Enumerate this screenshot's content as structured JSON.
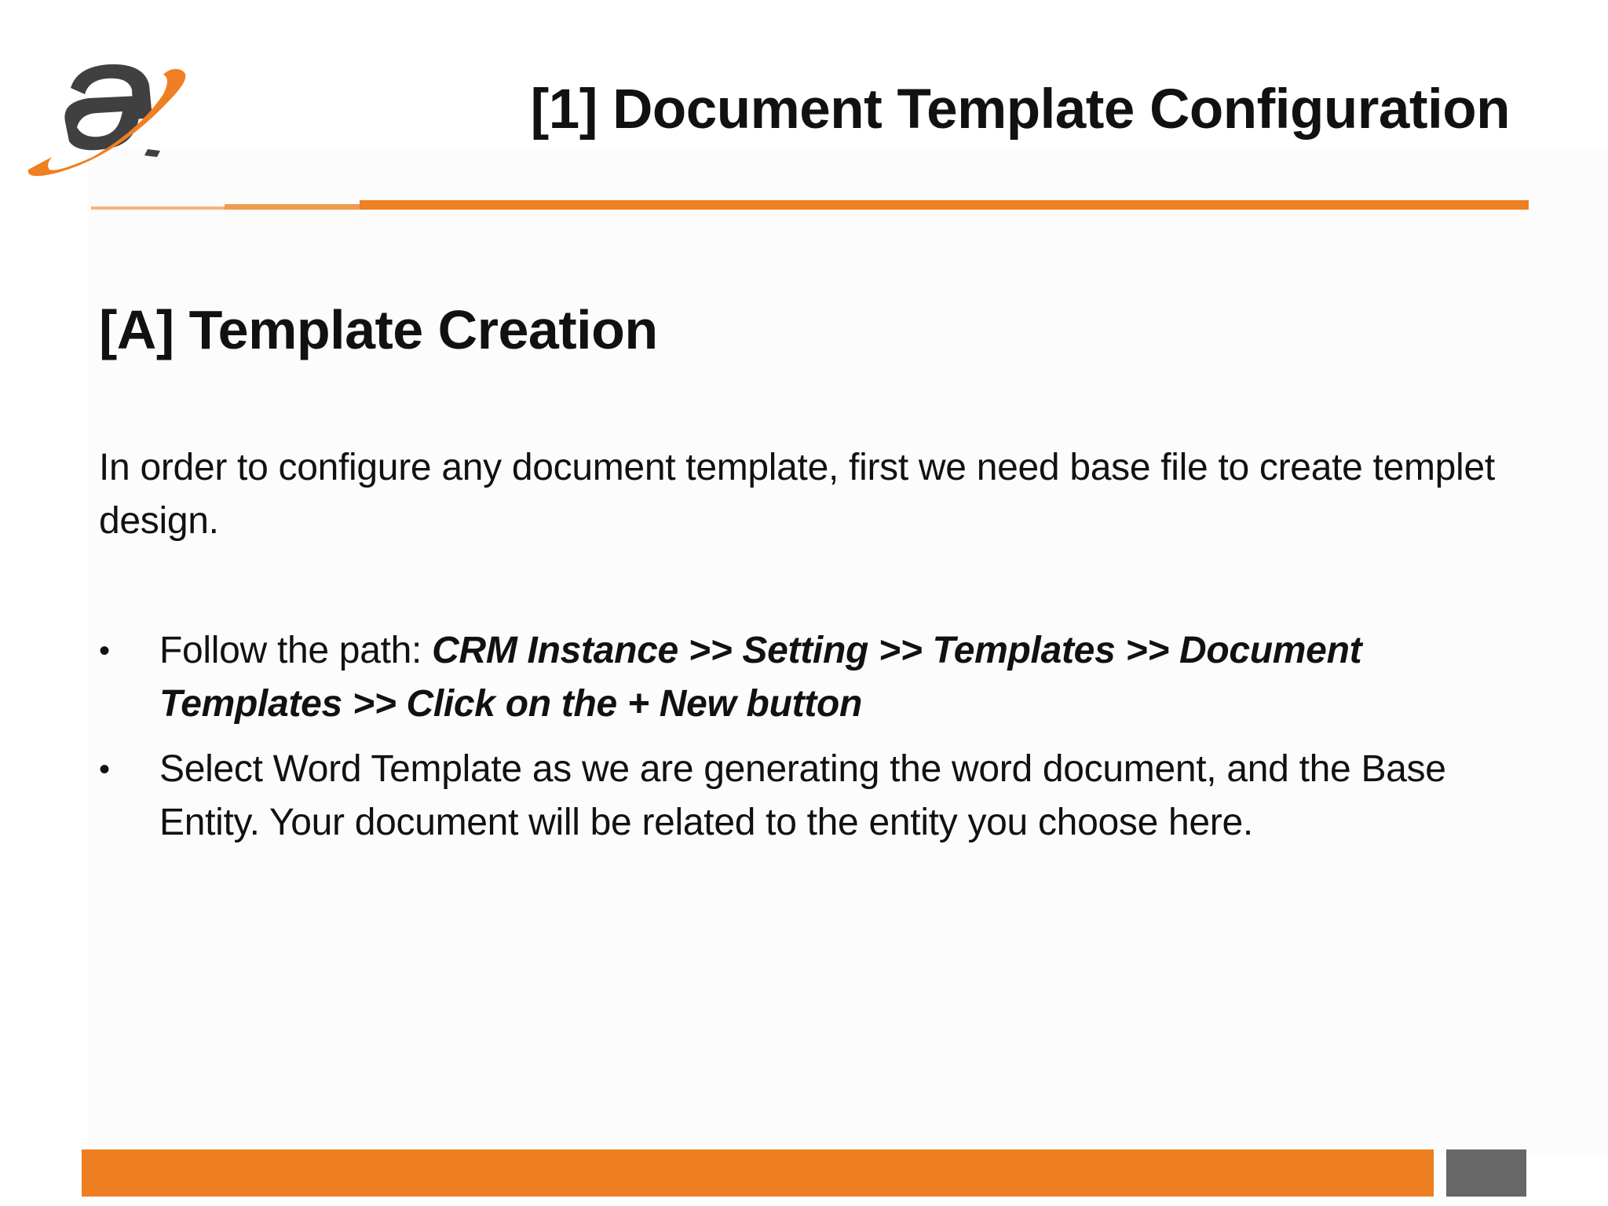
{
  "slide": {
    "title": "[1] Document Template Configuration",
    "section_heading": "[A] Template Creation",
    "intro": "In order to configure any document template, first we need base file to create templet design.",
    "bullets": [
      {
        "marker": "•",
        "prefix": "Follow the path: ",
        "emphasis": "CRM Instance >> Setting >> Templates >> Document Templates >> Click on the + New button",
        "text": ""
      },
      {
        "marker": "•",
        "prefix": "",
        "emphasis": "",
        "text": "Select Word Template as we are generating the word document, and the Base Entity. Your document will be related to the entity you choose here."
      }
    ]
  },
  "logo": {
    "icon": "company-logo-icon",
    "colors": {
      "dark": "#404040",
      "accent": "#ee7f22"
    }
  },
  "theme": {
    "accent": "#ee7f22",
    "footer_box": "#676767"
  }
}
